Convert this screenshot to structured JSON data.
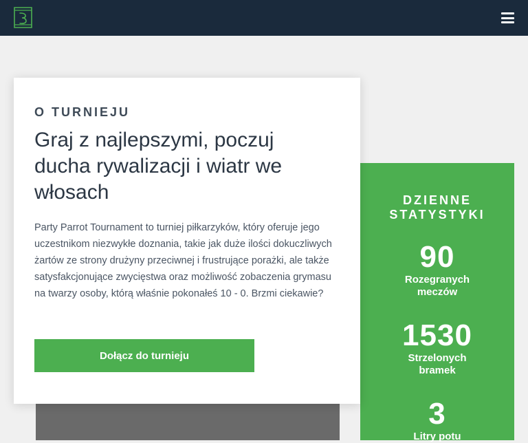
{
  "navbar": {
    "logo_icon": "beer-glass-logo-icon",
    "menu_icon": "hamburger-menu-icon"
  },
  "about": {
    "eyebrow": "O TURNIEJU",
    "headline": "Graj z najlepszymi, poczuj ducha rywalizacji i wiatr we włosach",
    "description": "Party Parrot Tournament to turniej piłkarzyków, który oferuje jego uczestnikom niezwykłe doznania, takie jak duże ilości dokuczliwych żartów ze strony drużyny przeciwnej i frustrujące porażki, ale także satysfakcjonujące zwycięstwa oraz możliwość zobaczenia grymasu na twarzy osoby, którą właśnie pokonałeś 10 - 0. Brzmi ciekawie?",
    "cta_label": "Dołącz do turnieju"
  },
  "stats": {
    "title": "DZIENNE STATYSTYKI",
    "items": [
      {
        "value": "90",
        "label": "Rozegranych meczów"
      },
      {
        "value": "1530",
        "label": "Strzelonych bramek"
      },
      {
        "value": "3",
        "label": "Litry potu"
      }
    ]
  },
  "colors": {
    "navbar": "#1a2a3c",
    "accent_green": "#4caf50",
    "background": "#f0f0f0",
    "heading_text": "#2c3744",
    "body_text": "#4a5563"
  }
}
